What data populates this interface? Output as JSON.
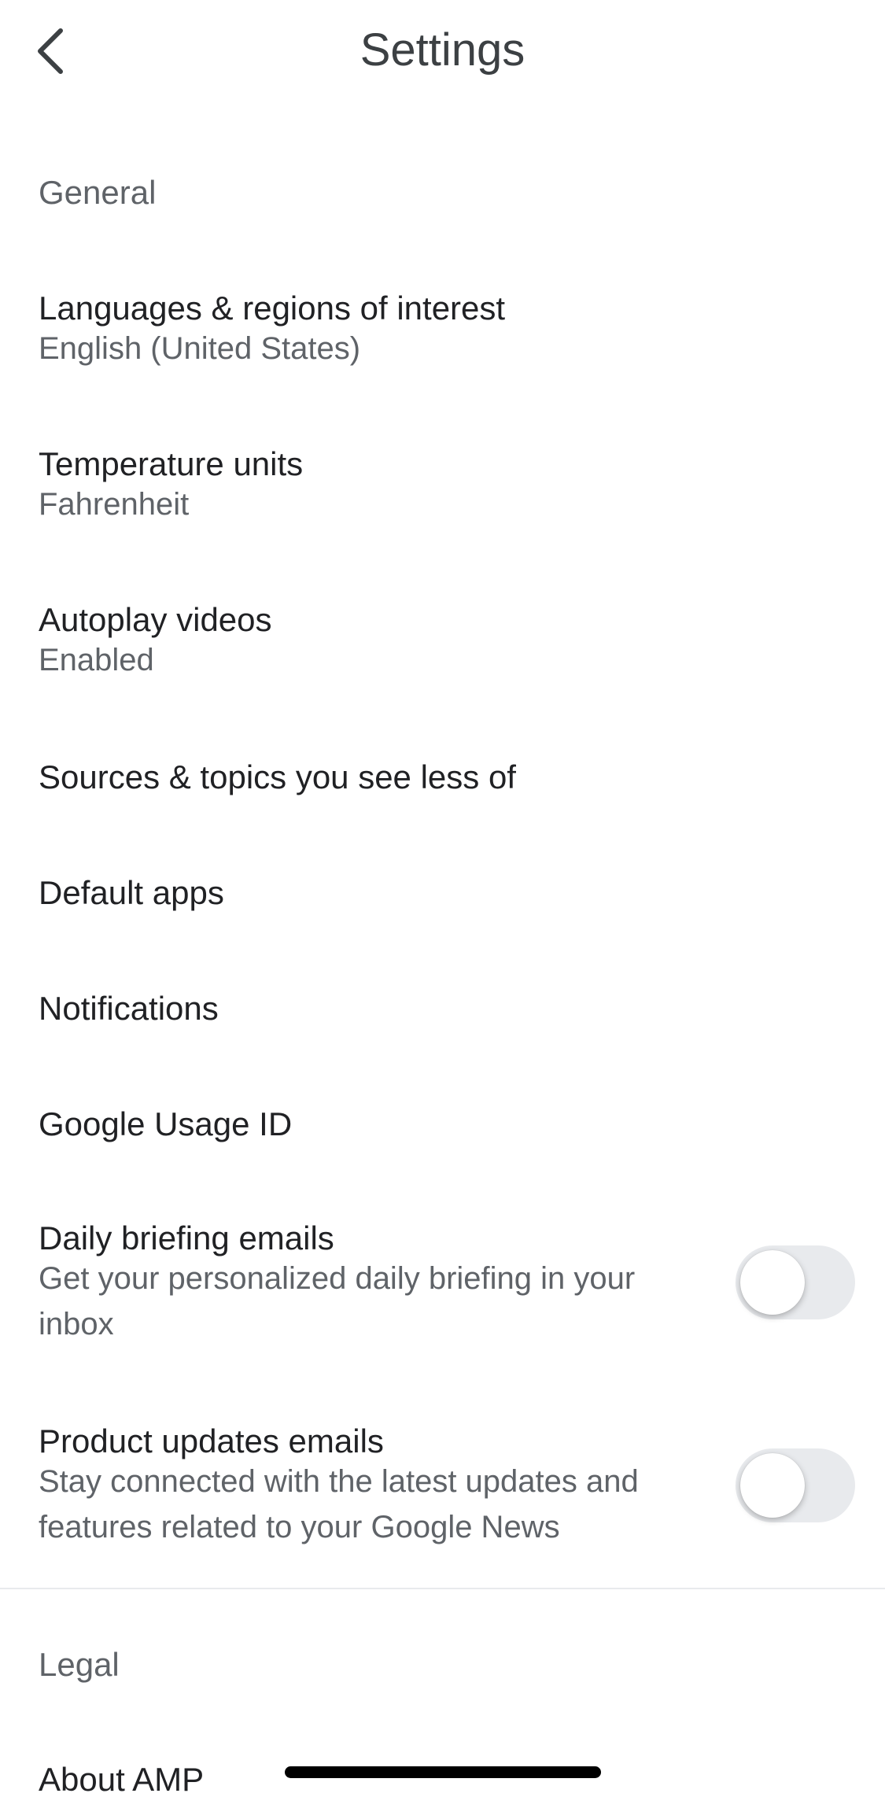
{
  "header": {
    "title": "Settings",
    "back_icon": "chevron-left-icon"
  },
  "sections": {
    "general": {
      "label": "General"
    },
    "legal": {
      "label": "Legal"
    }
  },
  "settings": {
    "languages": {
      "title": "Languages & regions of interest",
      "value": "English (United States)"
    },
    "temperature": {
      "title": "Temperature units",
      "value": "Fahrenheit"
    },
    "autoplay": {
      "title": "Autoplay videos",
      "value": "Enabled"
    },
    "sources": {
      "title": "Sources & topics you see less of"
    },
    "default_apps": {
      "title": "Default apps"
    },
    "notifications": {
      "title": "Notifications"
    },
    "usage_id": {
      "title": "Google Usage ID"
    },
    "daily_briefing": {
      "title": "Daily briefing emails",
      "description": "Get your personalized daily briefing in your inbox",
      "enabled": false
    },
    "product_updates": {
      "title": "Product updates emails",
      "description": "Stay connected with the latest updates and features related to your Google News",
      "enabled": false
    },
    "about_amp": {
      "title": "About AMP"
    }
  },
  "colors": {
    "title": "#202124",
    "secondary": "#5f6368",
    "toggle_off_track": "#e8eaed",
    "background": "#ffffff"
  }
}
